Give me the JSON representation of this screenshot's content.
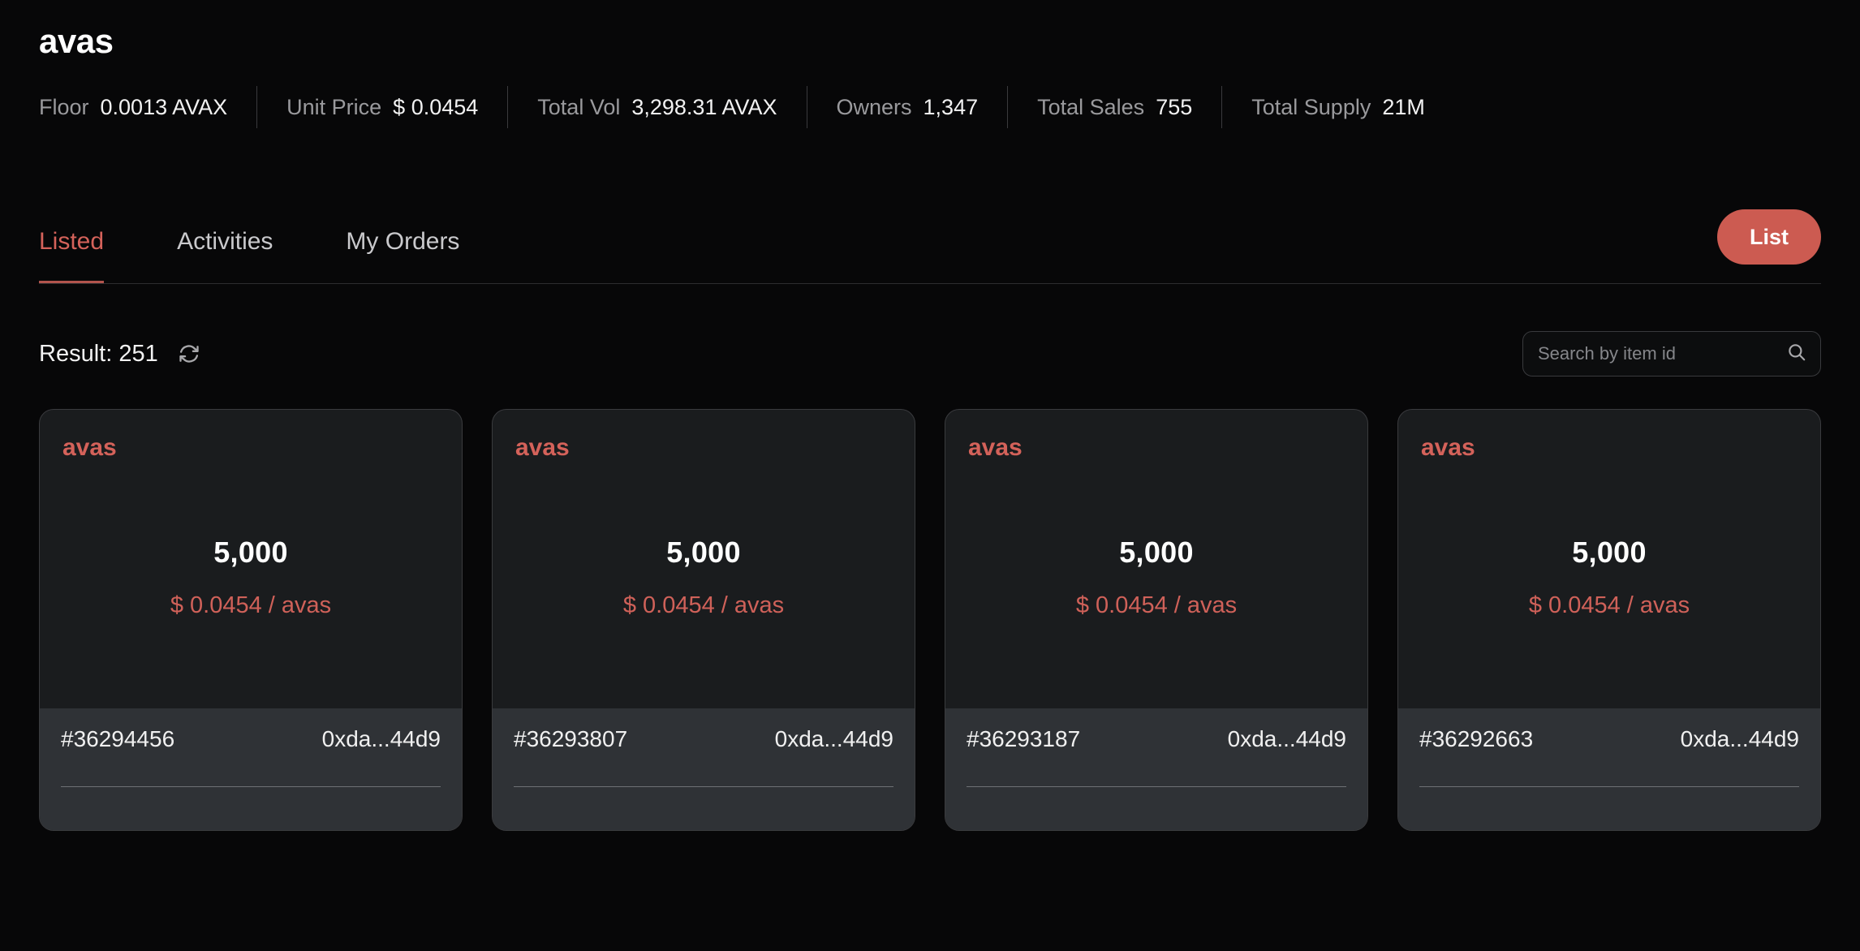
{
  "collection": {
    "title": "avas",
    "stats": [
      {
        "label": "Floor",
        "value": "0.0013 AVAX"
      },
      {
        "label": "Unit Price",
        "value": "$ 0.0454"
      },
      {
        "label": "Total Vol",
        "value": "3,298.31 AVAX"
      },
      {
        "label": "Owners",
        "value": "1,347"
      },
      {
        "label": "Total Sales",
        "value": "755"
      },
      {
        "label": "Total Supply",
        "value": "21M"
      }
    ]
  },
  "tabs": [
    {
      "label": "Listed",
      "active": true
    },
    {
      "label": "Activities",
      "active": false
    },
    {
      "label": "My Orders",
      "active": false
    }
  ],
  "actions": {
    "list_label": "List"
  },
  "toolbar": {
    "result_text": "Result: 251",
    "refresh_icon": "refresh-icon",
    "search_placeholder": "Search by item id",
    "search_value": "",
    "search_icon": "search-icon"
  },
  "cards": [
    {
      "ticker": "avas",
      "amount": "5,000",
      "price": "$ 0.0454 / avas",
      "item_id": "#36294456",
      "owner": "0xda...44d9"
    },
    {
      "ticker": "avas",
      "amount": "5,000",
      "price": "$ 0.0454 / avas",
      "item_id": "#36293807",
      "owner": "0xda...44d9"
    },
    {
      "ticker": "avas",
      "amount": "5,000",
      "price": "$ 0.0454 / avas",
      "item_id": "#36293187",
      "owner": "0xda...44d9"
    },
    {
      "ticker": "avas",
      "amount": "5,000",
      "price": "$ 0.0454 / avas",
      "item_id": "#36292663",
      "owner": "0xda...44d9"
    }
  ],
  "colors": {
    "background": "#070708",
    "accent": "#cc5b51",
    "accent_text": "#d4625a",
    "card_bg": "#1a1c1e",
    "card_footer_bg": "#2f3236",
    "muted_text": "#9a9a9d"
  }
}
